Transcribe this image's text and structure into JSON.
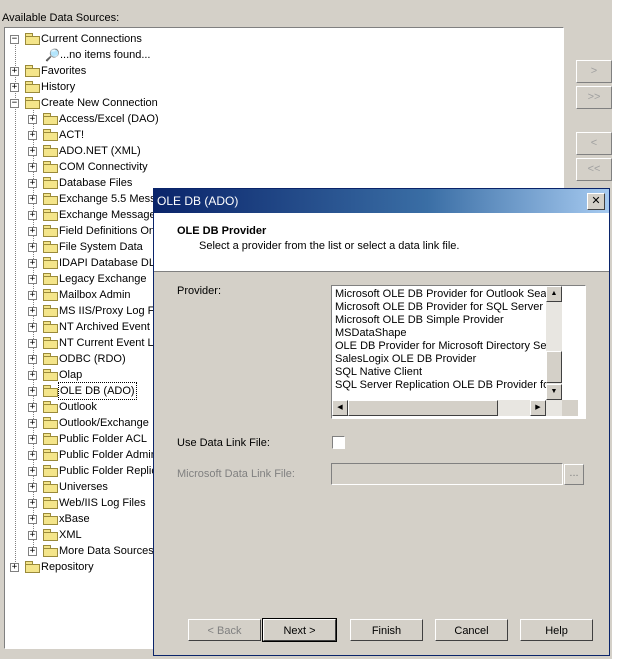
{
  "available_label": "Available Data Sources:",
  "tree": {
    "items": [
      {
        "label": "Current Connections",
        "level": 0,
        "expander": "−"
      },
      {
        "label": "...no items found...",
        "level": 1,
        "expander": "",
        "icon": "key"
      },
      {
        "label": "Favorites",
        "level": 0,
        "expander": "+"
      },
      {
        "label": "History",
        "level": 0,
        "expander": "+"
      },
      {
        "label": "Create New Connection",
        "level": 0,
        "expander": "−"
      },
      {
        "label": "Access/Excel (DAO)",
        "level": 1,
        "expander": "+"
      },
      {
        "label": "ACT!",
        "level": 1,
        "expander": "+"
      },
      {
        "label": "ADO.NET (XML)",
        "level": 1,
        "expander": "+"
      },
      {
        "label": "COM Connectivity",
        "level": 1,
        "expander": "+"
      },
      {
        "label": "Database Files",
        "level": 1,
        "expander": "+"
      },
      {
        "label": "Exchange 5.5 Mess",
        "level": 1,
        "expander": "+"
      },
      {
        "label": "Exchange Message",
        "level": 1,
        "expander": "+"
      },
      {
        "label": "Field Definitions On",
        "level": 1,
        "expander": "+"
      },
      {
        "label": "File System Data",
        "level": 1,
        "expander": "+"
      },
      {
        "label": "IDAPI Database DL",
        "level": 1,
        "expander": "+"
      },
      {
        "label": "Legacy Exchange",
        "level": 1,
        "expander": "+"
      },
      {
        "label": "Mailbox Admin",
        "level": 1,
        "expander": "+"
      },
      {
        "label": "MS IIS/Proxy Log F",
        "level": 1,
        "expander": "+"
      },
      {
        "label": "NT Archived Event",
        "level": 1,
        "expander": "+"
      },
      {
        "label": "NT Current Event L",
        "level": 1,
        "expander": "+"
      },
      {
        "label": "ODBC (RDO)",
        "level": 1,
        "expander": "+"
      },
      {
        "label": "Olap",
        "level": 1,
        "expander": "+"
      },
      {
        "label": "OLE DB (ADO)",
        "level": 1,
        "expander": "+",
        "selected": true
      },
      {
        "label": "Outlook",
        "level": 1,
        "expander": "+"
      },
      {
        "label": "Outlook/Exchange",
        "level": 1,
        "expander": "+"
      },
      {
        "label": "Public Folder ACL",
        "level": 1,
        "expander": "+"
      },
      {
        "label": "Public Folder Admin",
        "level": 1,
        "expander": "+"
      },
      {
        "label": "Public Folder Replic",
        "level": 1,
        "expander": "+"
      },
      {
        "label": "Universes",
        "level": 1,
        "expander": "+"
      },
      {
        "label": "Web/IIS Log Files",
        "level": 1,
        "expander": "+"
      },
      {
        "label": "xBase",
        "level": 1,
        "expander": "+"
      },
      {
        "label": "XML",
        "level": 1,
        "expander": "+"
      },
      {
        "label": "More Data Sources",
        "level": 1,
        "expander": "+"
      },
      {
        "label": "Repository",
        "level": 0,
        "expander": "+"
      }
    ]
  },
  "side_buttons": [
    ">",
    ">>",
    "<",
    "<<"
  ],
  "dialog": {
    "title": "OLE DB (ADO)",
    "close_glyph": "✕",
    "header_title": "OLE DB Provider",
    "header_subtitle": "Select a provider from the list or select a data link file.",
    "provider_label": "Provider:",
    "providers": [
      "Microsoft OLE DB Provider for Outlook Search",
      "Microsoft OLE DB Provider for SQL Server",
      "Microsoft OLE DB Simple Provider",
      "MSDataShape",
      "OLE DB Provider for Microsoft Directory Services",
      "SalesLogix OLE DB Provider",
      "SQL Native Client",
      "SQL Server Replication OLE DB Provider for DTS"
    ],
    "use_data_link_label": "Use Data Link File:",
    "use_data_link_checked": false,
    "data_link_label": "Microsoft Data Link File:",
    "data_link_value": "",
    "browse_label": "...",
    "buttons": {
      "back": "< Back",
      "next": "Next >",
      "finish": "Finish",
      "cancel": "Cancel",
      "help": "Help"
    }
  },
  "colors": {
    "titlebar_start": "#0a246a",
    "titlebar_end": "#a6caf0",
    "face": "#d4d0c8"
  }
}
